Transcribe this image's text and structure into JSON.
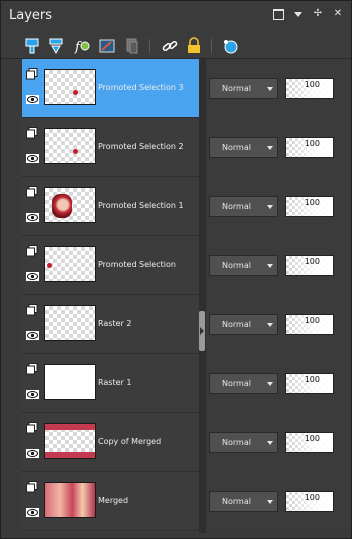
{
  "window": {
    "title": "Layers",
    "controls": [
      "restore-icon",
      "dropdown-icon",
      "pin-icon",
      "close-icon"
    ]
  },
  "toolbar": {
    "icons": [
      "new-raster-layer-icon",
      "new-vector-layer-icon",
      "new-adjustment-layer-icon",
      "new-mask-layer-icon",
      "duplicate-layer-icon",
      "link-layers-icon",
      "lock-transparency-icon",
      "layer-properties-icon"
    ]
  },
  "layers": [
    {
      "name": "Promoted Selection 3",
      "blend": "Normal",
      "opacity": "100",
      "active": true,
      "thumb": "dot-red"
    },
    {
      "name": "Promoted Selection 2",
      "blend": "Normal",
      "opacity": "100",
      "active": false,
      "thumb": "dot-red"
    },
    {
      "name": "Promoted Selection 1",
      "blend": "Normal",
      "opacity": "100",
      "active": false,
      "thumb": "face"
    },
    {
      "name": "Promoted Selection",
      "blend": "Normal",
      "opacity": "100",
      "active": false,
      "thumb": "dot-left"
    },
    {
      "name": "Raster 2",
      "blend": "Normal",
      "opacity": "100",
      "active": false,
      "thumb": "empty"
    },
    {
      "name": "Raster 1",
      "blend": "Normal",
      "opacity": "100",
      "active": false,
      "thumb": "white"
    },
    {
      "name": "Copy of Merged",
      "blend": "Normal",
      "opacity": "100",
      "active": false,
      "thumb": "copy-merged"
    },
    {
      "name": "Merged",
      "blend": "Normal",
      "opacity": "100",
      "active": false,
      "thumb": "merged"
    }
  ],
  "colors": {
    "selected_row": "#4aa3ee",
    "panel_bg": "#3b3b3b"
  }
}
